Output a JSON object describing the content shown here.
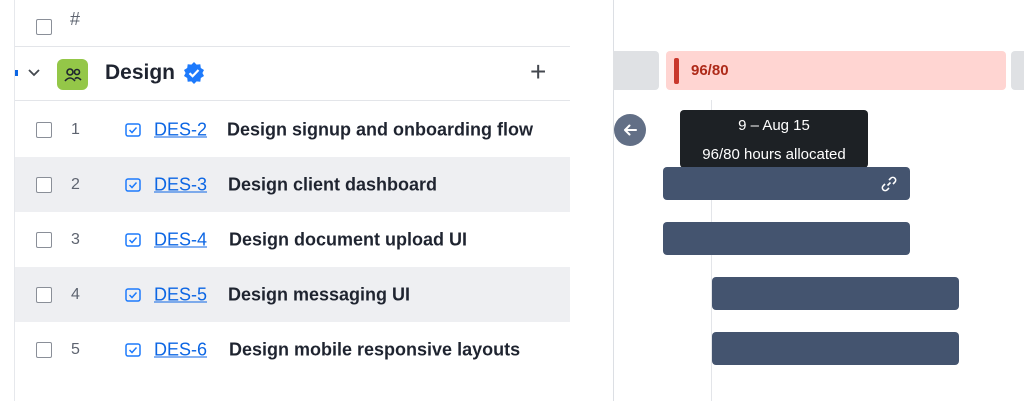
{
  "list": {
    "header_hash": "#",
    "group": {
      "name": "Design"
    },
    "tasks": [
      {
        "num": "1",
        "key": "DES-2",
        "title": "Design signup and onboarding flow"
      },
      {
        "num": "2",
        "key": "DES-3",
        "title": "Design client dashboard"
      },
      {
        "num": "3",
        "key": "DES-4",
        "title": "Design document upload UI"
      },
      {
        "num": "4",
        "key": "DES-5",
        "title": "Design messaging UI"
      },
      {
        "num": "5",
        "key": "DES-6",
        "title": "Design mobile responsive layouts"
      }
    ]
  },
  "timeline": {
    "capacity_label": "96/80",
    "tooltip": {
      "dates": "9 – Aug 15",
      "allocation": "96/80 hours allocated"
    }
  },
  "colors": {
    "accent": "#0c66e4",
    "bar": "#44546f",
    "over_capacity_bg": "#ffd5d2",
    "over_capacity_text": "#ae2a19",
    "team_icon": "#94c748"
  },
  "icons": {
    "checkbox": "checkbox-icon",
    "chevron": "chevron-down-icon",
    "team": "people-icon",
    "verified": "verified-badge-icon",
    "add": "plus-icon",
    "task": "task-checkbox-icon",
    "back": "arrow-left-icon",
    "link": "link-icon"
  }
}
